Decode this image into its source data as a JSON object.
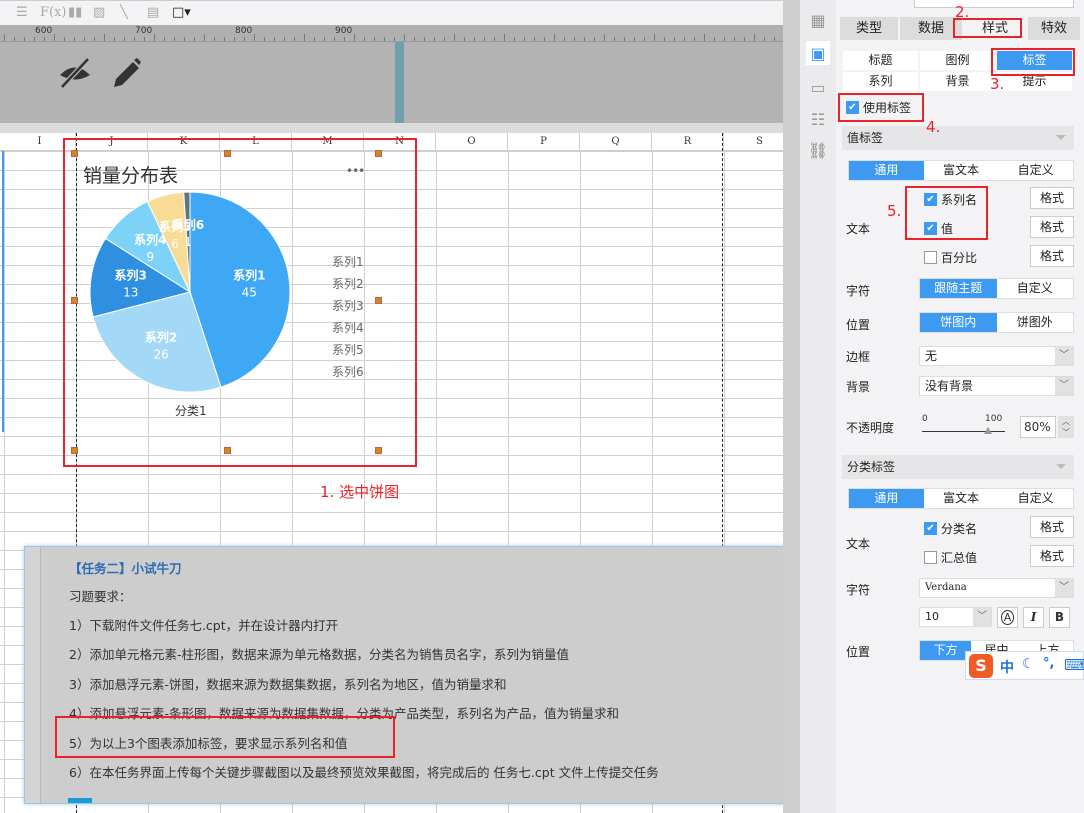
{
  "toolbar": {
    "icons": [
      "align-icon",
      "formula-icon",
      "bar-chart-icon",
      "image-icon",
      "slash-icon",
      "document-icon",
      "border-icon"
    ],
    "fx_label": "F(x)"
  },
  "ruler": {
    "labels": [
      "600",
      "700",
      "800",
      "900"
    ]
  },
  "columns": [
    "I",
    "J",
    "K",
    "L",
    "M",
    "N",
    "O",
    "P",
    "Q",
    "R",
    "S"
  ],
  "chart_data": {
    "type": "pie",
    "title": "销量分布表",
    "menu": "•••",
    "category_label": "分类1",
    "series": [
      {
        "name": "系列1",
        "value": 45,
        "color": "#3ea8f4"
      },
      {
        "name": "系列2",
        "value": 26,
        "color": "#a3d9f6"
      },
      {
        "name": "系列3",
        "value": 13,
        "color": "#2f8fe0"
      },
      {
        "name": "系列4",
        "value": 9,
        "color": "#7dd2f7"
      },
      {
        "name": "系列5",
        "value": 6,
        "color": "#f8db95"
      },
      {
        "name": "系列6",
        "value": 1,
        "color": "#5d7782"
      }
    ],
    "legend_position": "right"
  },
  "annotations": {
    "step1": "1. 选中饼图",
    "step2": "2.",
    "step3": "3.",
    "step4": "4.",
    "step5": "5."
  },
  "task": {
    "title": "【任务二】小试牛刀",
    "subtitle": "习题要求：",
    "lines": [
      "1）下载附件文件任务七.cpt，并在设计器内打开",
      "2）添加单元格元素-柱形图，数据来源为单元格数据，分类名为销售员名字，系列为销量值",
      "3）添加悬浮元素-饼图，数据来源为数据集数据，系列名为地区，值为销量求和",
      "4）添加悬浮元素-条形图，数据来源为数据集数据，分类为产品类型，系列名为产品，值为销量求和",
      "5）为以上3个图表添加标签，要求显示系列名和值",
      "6）在本任务界面上传每个关键步骤截图以及最终预览效果截图，将完成后的 任务七.cpt 文件上传提交任务"
    ]
  },
  "panel": {
    "tabs": [
      "类型",
      "数据",
      "样式",
      "特效"
    ],
    "active_tab": "样式",
    "subtabs": [
      "标题",
      "图例",
      "标签",
      "系列",
      "背景",
      "提示"
    ],
    "active_subtab": "标签",
    "use_label": "使用标签",
    "value_label": {
      "header": "值标签",
      "modes": [
        "通用",
        "富文本",
        "自定义"
      ],
      "text_label": "文本",
      "options": [
        {
          "label": "系列名",
          "checked": true
        },
        {
          "label": "值",
          "checked": true
        },
        {
          "label": "百分比",
          "checked": false
        }
      ],
      "format_btn": "格式",
      "char_label": "字符",
      "char_modes": [
        "跟随主题",
        "自定义"
      ],
      "pos_label": "位置",
      "pos_modes": [
        "饼图内",
        "饼图外"
      ],
      "border_label": "边框",
      "border_value": "无",
      "bg_label": "背景",
      "bg_value": "没有背景",
      "opacity_label": "不透明度",
      "opacity_min": "0",
      "opacity_max": "100",
      "opacity_value": "80%",
      "opacity_percent": 80
    },
    "category_label": {
      "header": "分类标签",
      "modes": [
        "通用",
        "富文本",
        "自定义"
      ],
      "text_label": "文本",
      "options": [
        {
          "label": "分类名",
          "checked": true
        },
        {
          "label": "汇总值",
          "checked": false
        }
      ],
      "format_btn": "格式",
      "char_label": "字符",
      "font": "Verdana",
      "size": "10",
      "style_btns": [
        "A",
        "I",
        "B"
      ],
      "pos_label": "位置",
      "pos_modes": [
        "下方",
        "居中",
        "上方"
      ]
    }
  },
  "ime": {
    "lang": "中",
    "punct": "°,"
  }
}
